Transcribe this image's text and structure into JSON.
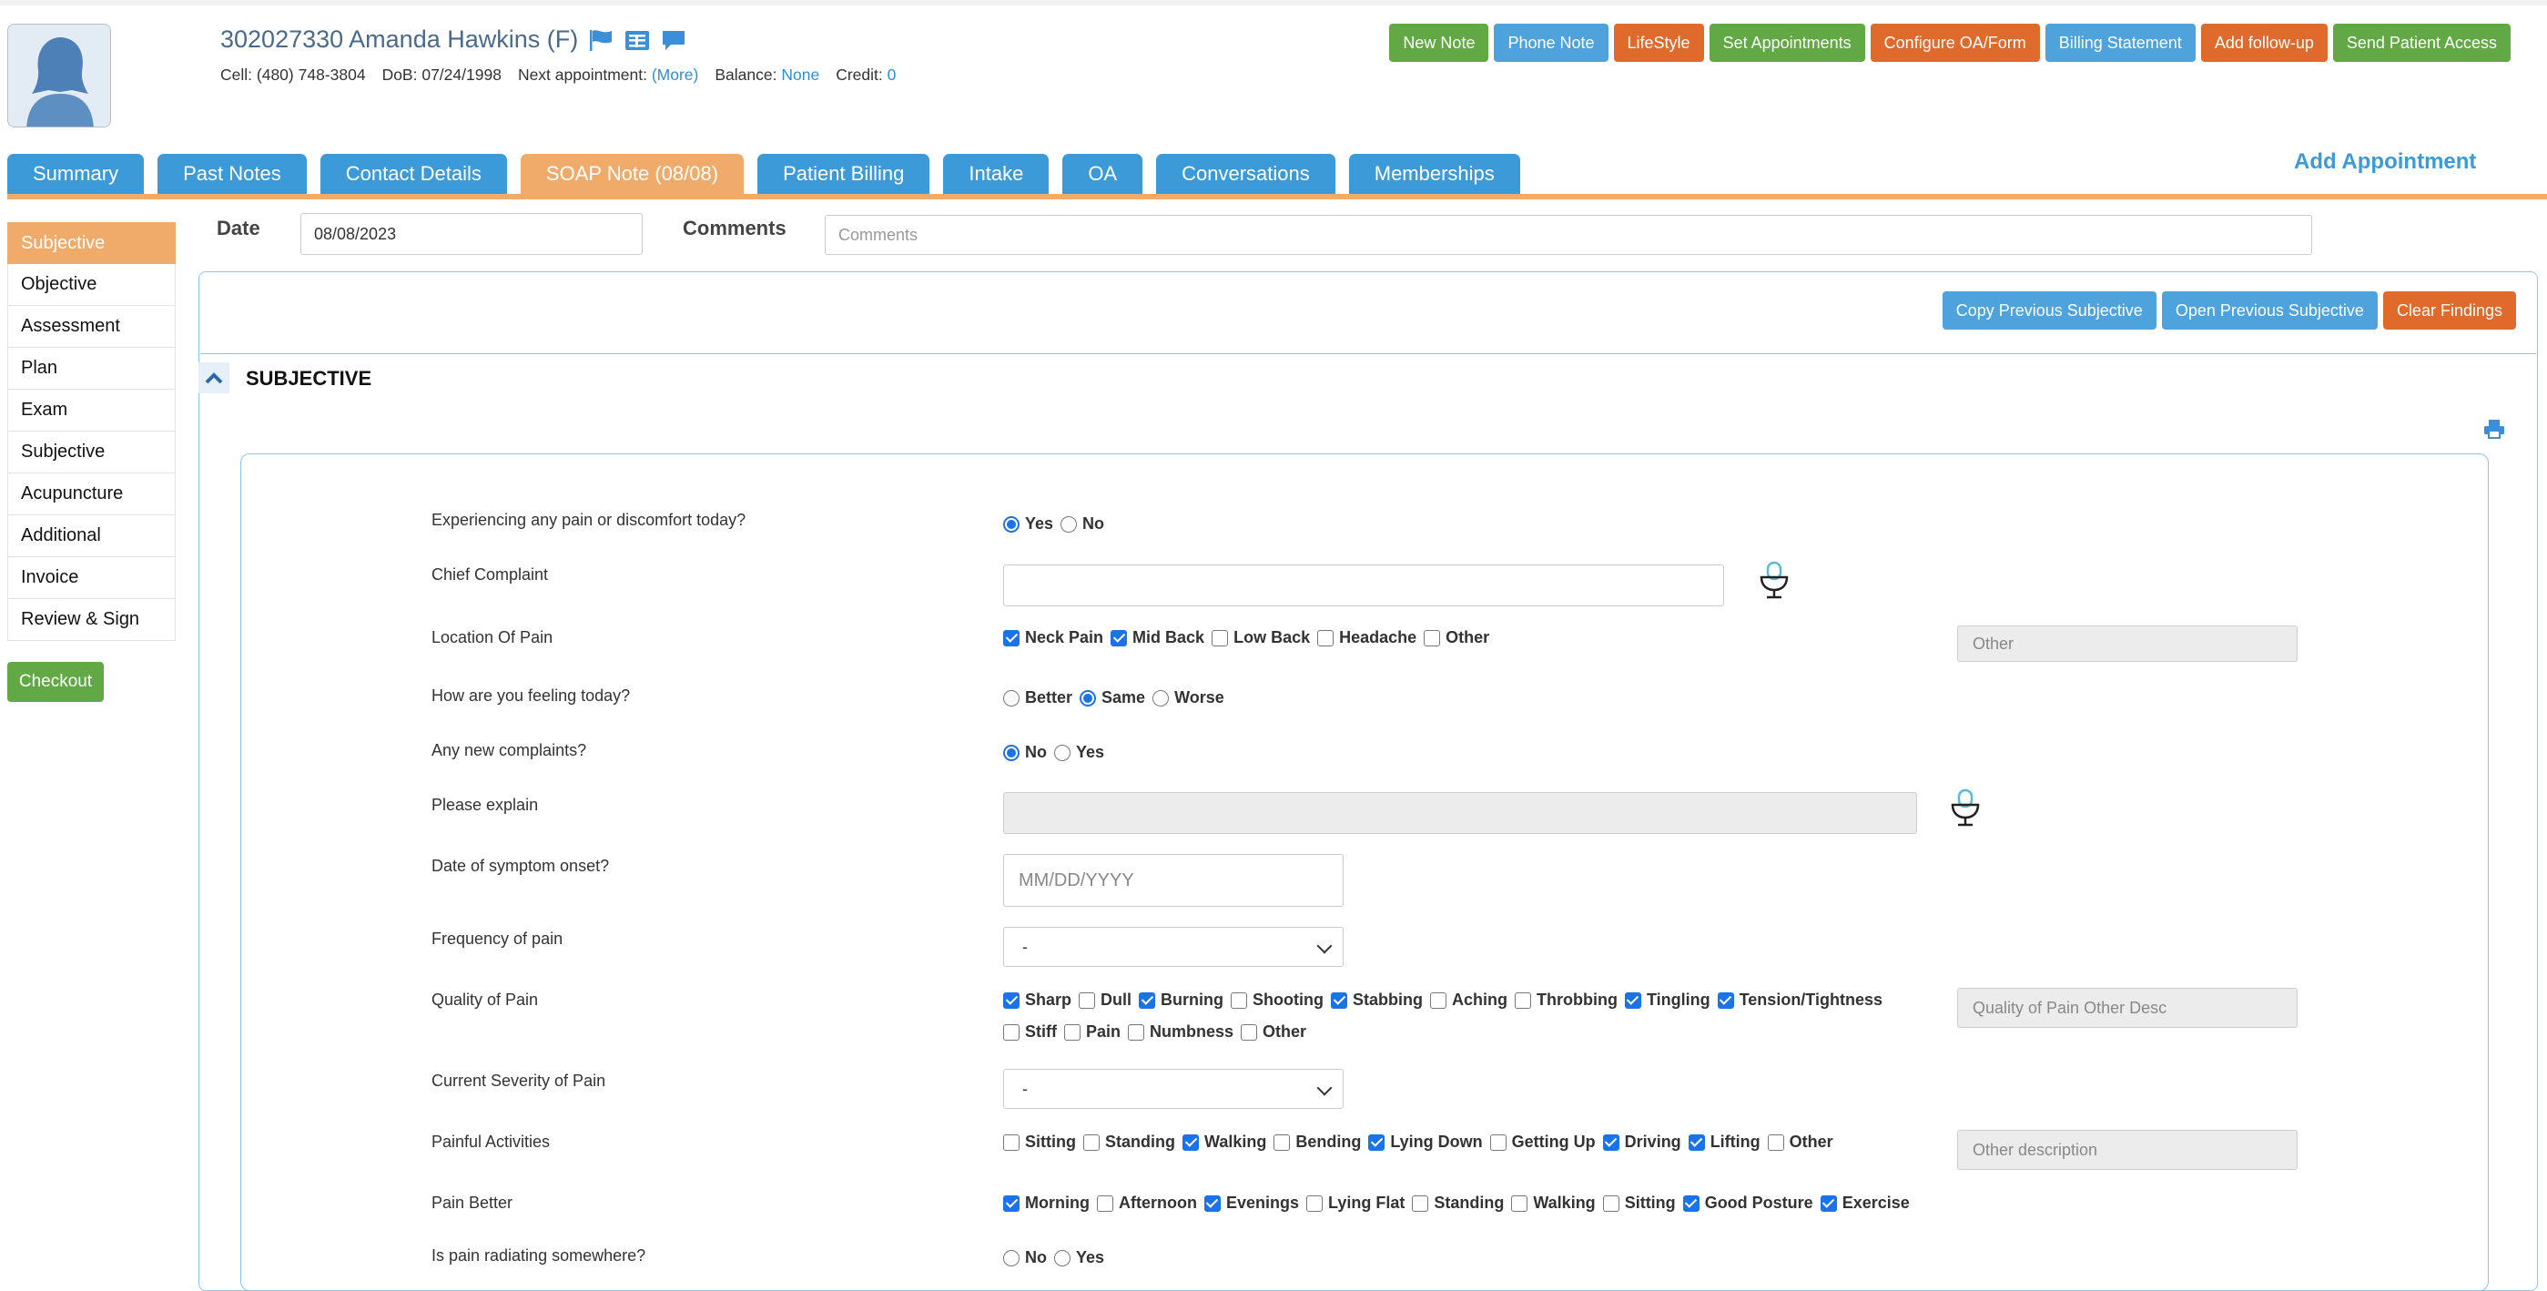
{
  "patient": {
    "name_line": "302027330 Amanda Hawkins (F)",
    "cell_label": "Cell:",
    "cell": "(480) 748-3804",
    "dob_label": "DoB:",
    "dob": "07/24/1998",
    "next_label": "Next appointment:",
    "next_link": "(More)",
    "balance_label": "Balance:",
    "balance": "None",
    "credit_label": "Credit:",
    "credit": "0",
    "icons": [
      "flag-icon",
      "id-card-icon",
      "chat-icon"
    ]
  },
  "header_buttons": [
    "New Note",
    "Phone Note",
    "LifeStyle",
    "Set Appointments",
    "Configure OA/Form",
    "Billing Statement",
    "Add follow-up",
    "Send Patient Access"
  ],
  "header_button_colors": [
    "#62a844",
    "#4ea3dd",
    "#e06a2c",
    "#62a844",
    "#e06a2c",
    "#4ea3dd",
    "#e06a2c",
    "#62a844"
  ],
  "tabs": [
    "Summary",
    "Past Notes",
    "Contact Details",
    "SOAP Note (08/08)",
    "Patient Billing",
    "Intake",
    "OA",
    "Conversations",
    "Memberships"
  ],
  "active_tab": "SOAP Note (08/08)",
  "add_appointment": "Add Appointment",
  "sidebar": [
    "Subjective",
    "Objective",
    "Assessment",
    "Plan",
    "Exam",
    "Subjective",
    "Acupuncture",
    "Additional",
    "Invoice",
    "Review & Sign"
  ],
  "checkout": "Checkout",
  "note": {
    "date_label": "Date",
    "date_value": "08/08/2023",
    "comments_label": "Comments",
    "comments_placeholder": "Comments"
  },
  "panel_buttons": [
    "Copy Previous Subjective",
    "Open Previous Subjective",
    "Clear Findings"
  ],
  "section_title": "SUBJECTIVE",
  "form": {
    "pain_today": {
      "label": "Experiencing any pain or discomfort today?",
      "options": [
        {
          "t": "Yes",
          "on": true
        },
        {
          "t": "No",
          "on": false
        }
      ]
    },
    "chief_complaint": {
      "label": "Chief Complaint",
      "value": ""
    },
    "location": {
      "label": "Location Of Pain",
      "options": [
        {
          "t": "Neck Pain",
          "on": true
        },
        {
          "t": "Mid Back",
          "on": true
        },
        {
          "t": "Low Back",
          "on": false
        },
        {
          "t": "Headache",
          "on": false
        },
        {
          "t": "Other",
          "on": false
        }
      ],
      "other_placeholder": "Other"
    },
    "feeling": {
      "label": "How are you feeling today?",
      "options": [
        {
          "t": "Better",
          "on": false
        },
        {
          "t": "Same",
          "on": true
        },
        {
          "t": "Worse",
          "on": false
        }
      ]
    },
    "new_complaints": {
      "label": "Any new complaints?",
      "options": [
        {
          "t": "No",
          "on": true
        },
        {
          "t": "Yes",
          "on": false
        }
      ]
    },
    "explain": {
      "label": "Please explain",
      "value": ""
    },
    "onset": {
      "label": "Date of symptom onset?",
      "placeholder": "MM/DD/YYYY"
    },
    "frequency": {
      "label": "Frequency of pain",
      "value": "-"
    },
    "quality": {
      "label": "Quality of Pain",
      "options": [
        {
          "t": "Sharp",
          "on": true
        },
        {
          "t": "Dull",
          "on": false
        },
        {
          "t": "Burning",
          "on": true
        },
        {
          "t": "Shooting",
          "on": false
        },
        {
          "t": "Stabbing",
          "on": true
        },
        {
          "t": "Aching",
          "on": false
        },
        {
          "t": "Throbbing",
          "on": false
        },
        {
          "t": "Tingling",
          "on": true
        },
        {
          "t": "Tension/Tightness",
          "on": true
        },
        {
          "t": "Stiff",
          "on": false
        },
        {
          "t": "Pain",
          "on": false
        },
        {
          "t": "Numbness",
          "on": false
        },
        {
          "t": "Other",
          "on": false
        }
      ],
      "other_placeholder": "Quality of Pain Other Desc"
    },
    "severity": {
      "label": "Current Severity of Pain",
      "value": "-"
    },
    "activities": {
      "label": "Painful Activities",
      "options": [
        {
          "t": "Sitting",
          "on": false
        },
        {
          "t": "Standing",
          "on": false
        },
        {
          "t": "Walking",
          "on": true
        },
        {
          "t": "Bending",
          "on": false
        },
        {
          "t": "Lying Down",
          "on": true
        },
        {
          "t": "Getting Up",
          "on": false
        },
        {
          "t": "Driving",
          "on": true
        },
        {
          "t": "Lifting",
          "on": true
        },
        {
          "t": "Other",
          "on": false
        }
      ],
      "other_placeholder": "Other description"
    },
    "pain_better": {
      "label": "Pain Better",
      "options": [
        {
          "t": "Morning",
          "on": true
        },
        {
          "t": "Afternoon",
          "on": false
        },
        {
          "t": "Evenings",
          "on": true
        },
        {
          "t": "Lying Flat",
          "on": false
        },
        {
          "t": "Standing",
          "on": false
        },
        {
          "t": "Walking",
          "on": false
        },
        {
          "t": "Sitting",
          "on": false
        },
        {
          "t": "Good Posture",
          "on": true
        },
        {
          "t": "Exercise",
          "on": true
        }
      ]
    },
    "radiating": {
      "label": "Is pain radiating somewhere?",
      "options": [
        {
          "t": "No",
          "on": false
        },
        {
          "t": "Yes",
          "on": false
        }
      ]
    }
  }
}
